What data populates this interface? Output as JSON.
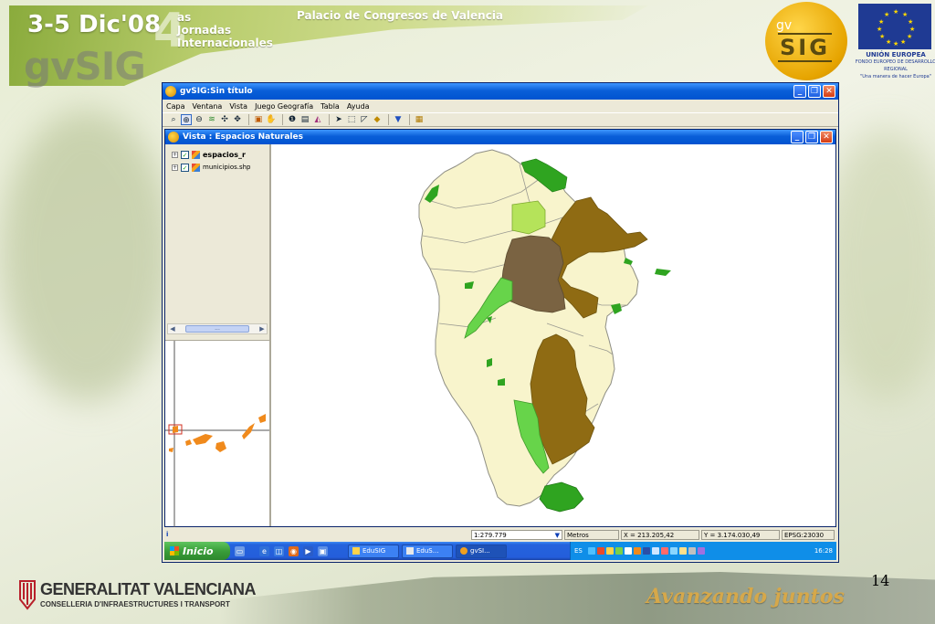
{
  "slide": {
    "event_date": "3-5 Dic'08",
    "event_number": "4",
    "event_lines": [
      "as",
      "Jornadas",
      "Internacionales"
    ],
    "event_brand": "gvSIG",
    "event_venue": "Palacio de Congresos de Valencia",
    "logo_small": "gv",
    "logo_big": "SIG",
    "eu_title": "UNIÓN EUROPEA",
    "eu_fund": "FONDO EUROPEO DE DESARROLLO REGIONAL",
    "eu_motto": "\"Una manera de hacer Europa\"",
    "footer_org": "GENERALITAT VALENCIANA",
    "footer_dept": "CONSELLERIA D'INFRAESTRUCTURES I TRANSPORT",
    "footer_slogan": "Avanzando juntos",
    "page_number": "14"
  },
  "app": {
    "title": "gvSIG:Sin título",
    "menu": [
      "Capa",
      "Ventana",
      "Vista",
      "Juego Geografía",
      "Tabla",
      "Ayuda"
    ],
    "toolbar_icons": [
      "zoom-select-icon",
      "zoom-in-icon",
      "zoom-out-icon",
      "layers-icon",
      "zoom-full-icon",
      "zoom-extent-icon",
      "frame-icon",
      "pan-hand-icon",
      "info-icon",
      "print-icon",
      "measure-icon",
      "select-pointer-icon",
      "select-rect-icon",
      "select-poly-icon",
      "select-layer-icon",
      "filter-icon",
      "table-icon"
    ]
  },
  "view": {
    "title": "Vista : Espacios Naturales",
    "layers": [
      {
        "name": "espacios_r",
        "checked": true,
        "active": true
      },
      {
        "name": "municipios.shp",
        "checked": true,
        "active": false
      }
    ],
    "scroll_thumb": "..."
  },
  "status": {
    "info": "i",
    "scale": "1:279.779",
    "units": "Metros",
    "x": "X = 213.205,42",
    "y": "Y = 3.174.030,49",
    "epsg": "EPSG:23030"
  },
  "taskbar": {
    "start": "Inicio",
    "tasks": [
      {
        "label": "EduSIG",
        "active": false
      },
      {
        "label": "EduS...",
        "active": false
      },
      {
        "label": "gvSI...",
        "active": true
      }
    ],
    "lang": "ES",
    "clock": "16:28"
  },
  "colors": {
    "island_fill": "#f8f4cc",
    "brown_dark": "#7a6342",
    "brown_olive": "#8f6b13",
    "green_light": "#67d44a",
    "green_lime": "#b5e35a",
    "green_dark": "#2fa420",
    "canarias_orange": "#f08a1c"
  }
}
